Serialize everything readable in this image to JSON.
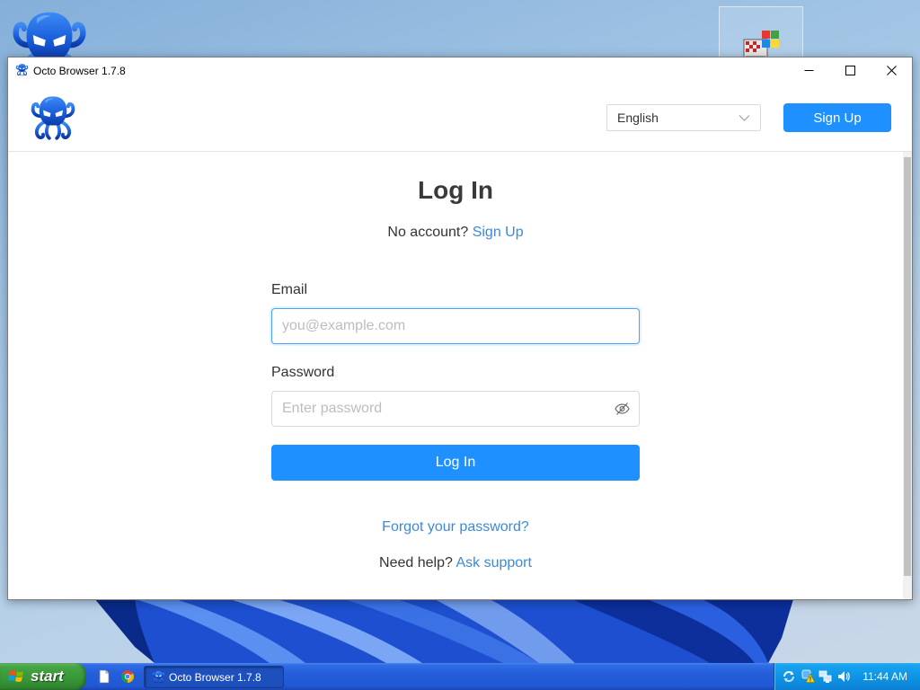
{
  "desktop": {
    "icons": [
      {
        "icon": "octo-browser-icon"
      },
      {
        "icon": "windows-setup-icon"
      }
    ]
  },
  "window": {
    "title": "Octo Browser 1.7.8",
    "app_icon": "octopus-icon",
    "controls": [
      "minimize-icon",
      "maximize-icon",
      "close-icon"
    ]
  },
  "header": {
    "logo": "octopus-logo",
    "language": {
      "selected": "English",
      "icon": "chevron-down-icon"
    },
    "signup_button": "Sign Up"
  },
  "login": {
    "title": "Log In",
    "no_account_text": "No account?",
    "signup_link": "Sign Up",
    "email": {
      "label": "Email",
      "value": "",
      "placeholder": "you@example.com",
      "focused": true
    },
    "password": {
      "label": "Password",
      "value": "",
      "placeholder": "Enter password",
      "toggle_icon": "eye-slash-icon"
    },
    "submit_button": "Log In",
    "forgot_link": "Forgot your password?",
    "help_text": "Need help?",
    "support_link": "Ask support"
  },
  "taskbar": {
    "start_label": "start",
    "quick_launch": [
      {
        "icon": "document-icon"
      },
      {
        "icon": "chrome-icon"
      }
    ],
    "tasks": [
      {
        "label": "Octo Browser 1.7.8",
        "icon": "octopus-icon",
        "active": true
      }
    ],
    "tray_icons": [
      "sync-icon",
      "warning-icon",
      "network-icon",
      "volume-icon"
    ],
    "clock": "11:44 AM"
  },
  "colors": {
    "accent": "#1e90ff",
    "link": "#3b89d9",
    "text": "#333333",
    "input_focus_border": "#4ea3f2",
    "taskbar": "#245edb",
    "start_button": "#3a9a3a",
    "tray": "#0f95e6"
  }
}
